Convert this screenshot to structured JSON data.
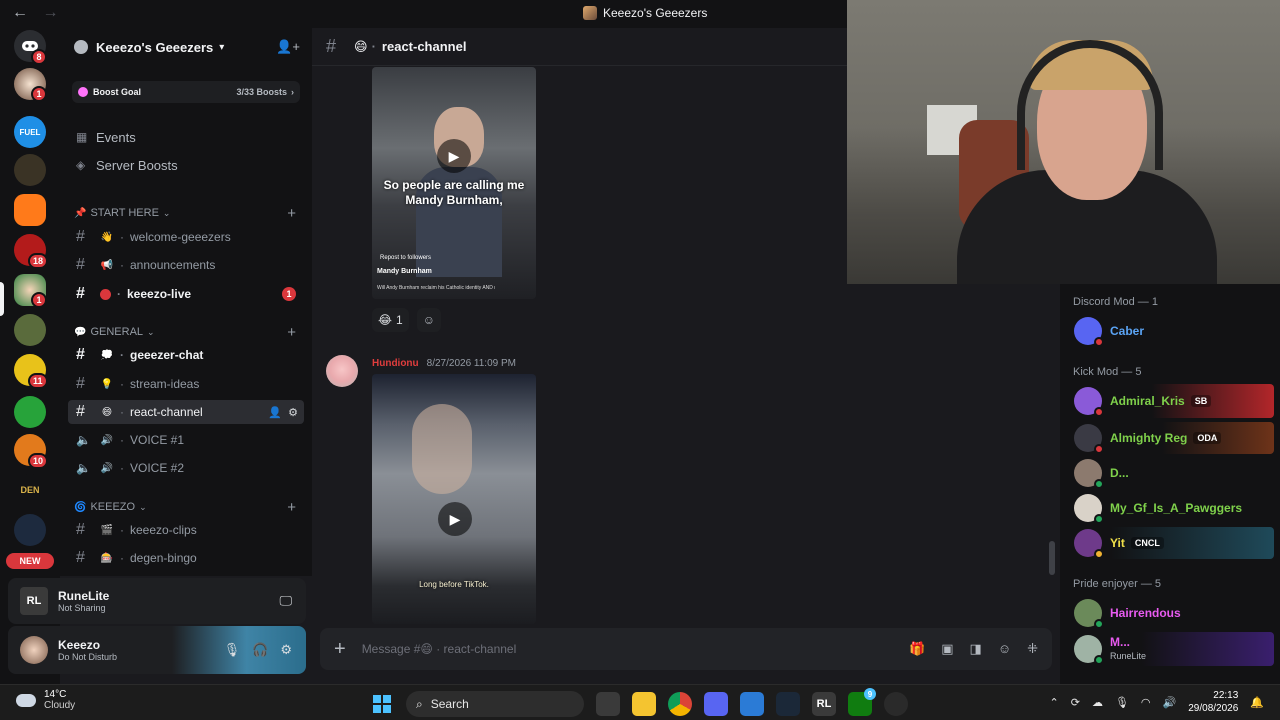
{
  "window": {
    "title": "Keeezo's Geeezers",
    "back_icon": "←",
    "forward_icon": "→"
  },
  "server_rail": {
    "badges": [
      "8",
      "1",
      "18",
      "1",
      "11",
      "10"
    ],
    "new_label": "NEW",
    "den_label": "DEN"
  },
  "server": {
    "name": "Keeezo's Geeezers",
    "boost_goal_label": "Boost Goal",
    "boost_count": "3/33 Boosts",
    "events_label": "Events",
    "server_boosts_label": "Server Boosts"
  },
  "categories": {
    "start_here": "START HERE",
    "general": "GENERAL",
    "keeezo": "KEEEZO"
  },
  "channels": {
    "welcome": "welcome-geeezers",
    "announcements": "announcements",
    "keeezo_live": "keeezo-live",
    "keeezo_live_badge": "1",
    "geeezer_chat": "geeezer-chat",
    "stream_ideas": "stream-ideas",
    "react_channel": "react-channel",
    "voice1": "VOICE #1",
    "voice2": "VOICE #2",
    "keeezo_clips": "keeezo-clips",
    "degen_bingo": "degen-bingo"
  },
  "activity": {
    "name": "RuneLite",
    "status": "Not Sharing"
  },
  "user": {
    "name": "Keeezo",
    "status": "Do Not Disturb"
  },
  "chat": {
    "channel_name": "react-channel",
    "video1_caption_line1": "So people are calling me",
    "video1_caption_line2": "Mandy Burnham,",
    "video1_repost": "Repost to followers",
    "video1_account": "Mandy Burnham",
    "video1_desc": "Will Andy Burnham reclaim his Catholic identity AND religious practice?... more",
    "reaction_count": "1",
    "msg2_author": "Hundionu",
    "msg2_time": "8/27/2026 11:09 PM",
    "video2_caption": "Long before TikTok.",
    "composer_placeholder": "Message #😄 · react-channel"
  },
  "members": {
    "discord_mod_header": "Discord Mod — 1",
    "kick_mod_header": "Kick Mod — 5",
    "pride_header": "Pride enjoyer — 5",
    "list": [
      {
        "name": "Caber",
        "color": "#5ba4f5"
      },
      {
        "name": "Admiral_Kris",
        "tag": "SB",
        "color": "#7fd14b"
      },
      {
        "name": "Almighty Reg",
        "tag": "ODA",
        "color": "#7fd14b"
      },
      {
        "name": "D...",
        "color": "#7fd14b"
      },
      {
        "name": "My_Gf_Is_A_Pawggers",
        "color": "#7fd14b"
      },
      {
        "name": "Yit",
        "tag": "CNCL",
        "color": "#f0e04a"
      },
      {
        "name": "Hairrendous",
        "color": "#e85bf0"
      },
      {
        "name": "M...",
        "sub": "RuneLite",
        "color": "#e85bf0"
      }
    ]
  },
  "taskbar": {
    "temperature": "14°C",
    "weather": "Cloudy",
    "search_label": "Search",
    "time": "22:13",
    "date": "29/08/2026",
    "notif_badge": "9"
  }
}
